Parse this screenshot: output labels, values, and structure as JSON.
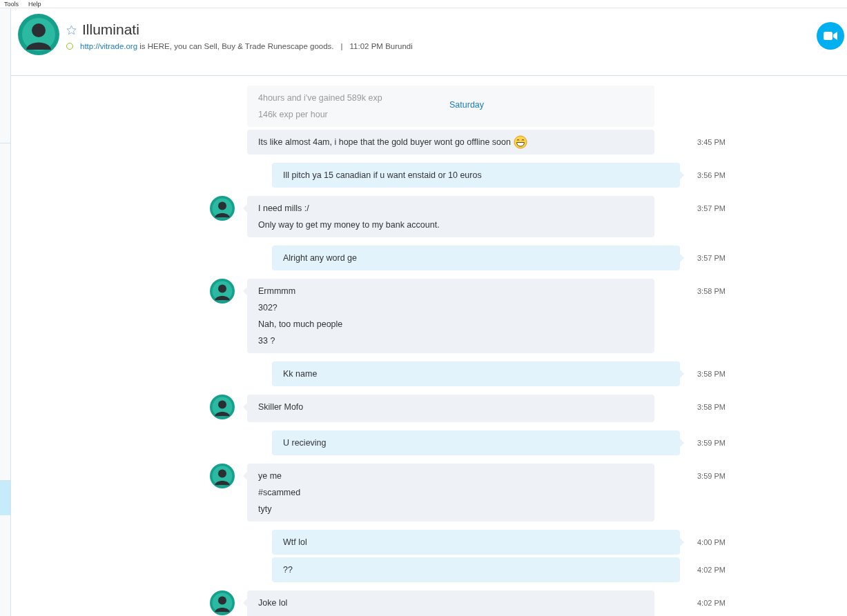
{
  "menu": [
    "Tools",
    "Help"
  ],
  "sidebar": {
    "items": [
      {
        "selected": false
      },
      {
        "selected": false
      },
      {
        "selected": true
      }
    ]
  },
  "header": {
    "title": "Illuminati",
    "favorite": false,
    "online": true,
    "link": "http://vitrade.org",
    "mood": " is HERE, you can Sell, Buy & Trade Runescape goods.",
    "separator": "|",
    "local_time": "11:02 PM Burundi"
  },
  "chat": {
    "day_label": "Saturday",
    "messages": [
      {
        "kind": "incoming",
        "faded": true,
        "avatar": false,
        "grouped": false,
        "lines": [
          "4hours and i've gained 589k exp",
          "146k exp per hour"
        ]
      },
      {
        "kind": "incoming",
        "faded": false,
        "avatar": false,
        "grouped": true,
        "emoji": true,
        "lines": [
          "Its like almost 4am, i hope that the gold buyer wont go offline soon"
        ],
        "time": "3:45 PM"
      },
      {
        "kind": "outgoing",
        "faded": false,
        "grouped": false,
        "lines": [
          "Ill pitch ya 15 canadian if u want enstaid or 10 euros"
        ],
        "time": "3:56 PM"
      },
      {
        "kind": "incoming",
        "faded": false,
        "avatar": true,
        "grouped": false,
        "lines": [
          "I need mills :/",
          "Only way to get my money to my bank account."
        ],
        "time": "3:57 PM"
      },
      {
        "kind": "outgoing",
        "faded": false,
        "grouped": false,
        "lines": [
          "Alright any word ge"
        ],
        "time": "3:57 PM"
      },
      {
        "kind": "incoming",
        "faded": false,
        "avatar": true,
        "grouped": false,
        "lines": [
          "Ermmmm",
          "302?",
          "Nah, too much people",
          "33 ?"
        ],
        "time": "3:58 PM"
      },
      {
        "kind": "outgoing",
        "faded": false,
        "grouped": false,
        "lines": [
          "Kk name"
        ],
        "time": "3:58 PM"
      },
      {
        "kind": "incoming",
        "faded": false,
        "avatar": true,
        "grouped": false,
        "lines": [
          "Skiller Mofo"
        ],
        "time": "3:58 PM"
      },
      {
        "kind": "outgoing",
        "faded": false,
        "grouped": false,
        "lines": [
          "U recieving"
        ],
        "time": "3:59 PM"
      },
      {
        "kind": "incoming",
        "faded": false,
        "avatar": true,
        "grouped": false,
        "lines": [
          "ye me",
          "#scammed",
          "tyty"
        ],
        "time": "3:59 PM"
      },
      {
        "kind": "outgoing",
        "faded": false,
        "grouped": false,
        "lines": [
          "Wtf lol"
        ],
        "time": "4:00 PM"
      },
      {
        "kind": "outgoing",
        "faded": false,
        "grouped": true,
        "lines": [
          "??"
        ],
        "time": "4:02 PM"
      },
      {
        "kind": "incoming",
        "faded": false,
        "avatar": true,
        "grouped": false,
        "lines": [
          "Joke lol"
        ],
        "time": "4:02 PM"
      }
    ]
  }
}
